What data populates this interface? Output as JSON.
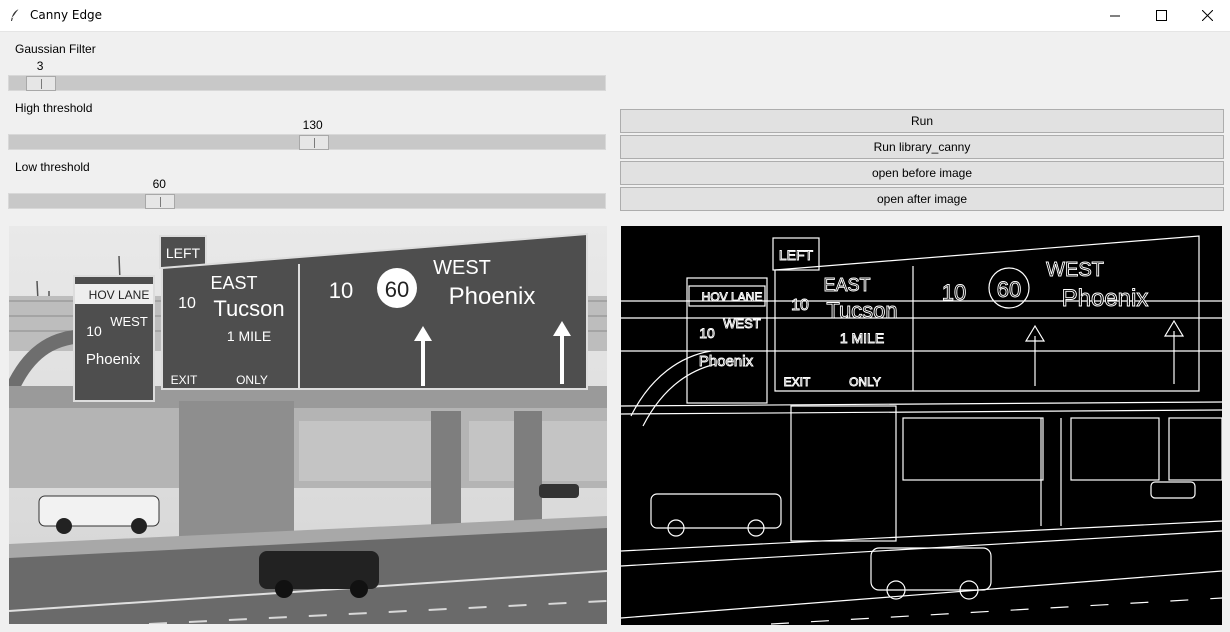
{
  "window": {
    "title": "Canny Edge",
    "icon": "feather-icon",
    "controls": [
      "minimize-icon",
      "maximize-icon",
      "close-icon"
    ]
  },
  "sliders": {
    "gaussian": {
      "label": "Gaussian Filter",
      "value": "3",
      "fraction": 0.03
    },
    "high": {
      "label": "High threshold",
      "value": "130",
      "fraction": 0.51
    },
    "low": {
      "label": "Low threshold",
      "value": "60",
      "fraction": 0.24
    }
  },
  "buttons": {
    "run": "Run",
    "run_library": "Run library_canny",
    "open_before": "open before image",
    "open_after": "open after image"
  },
  "images": {
    "before": {
      "sign_left": "LEFT",
      "hov": "HOV LANE",
      "route10": "10",
      "west": "WEST",
      "phoenix": "Phoenix",
      "east": "EAST",
      "tucson": "Tucson",
      "mile": "1 MILE",
      "route60": "60",
      "exit": "EXIT",
      "only": "ONLY"
    },
    "after": {
      "sign_left": "LEFT",
      "hov": "HOV LANE",
      "route10": "10",
      "west": "WEST",
      "phoenix": "Phoenix",
      "east": "EAST",
      "tucson": "Tucson",
      "mile": "1 MILE",
      "route60": "60",
      "exit": "EXIT",
      "only": "ONLY"
    }
  },
  "colors": {
    "window_bg": "#f0f0f0",
    "trough": "#c8c8c8",
    "button_bg": "#e1e1e1"
  }
}
